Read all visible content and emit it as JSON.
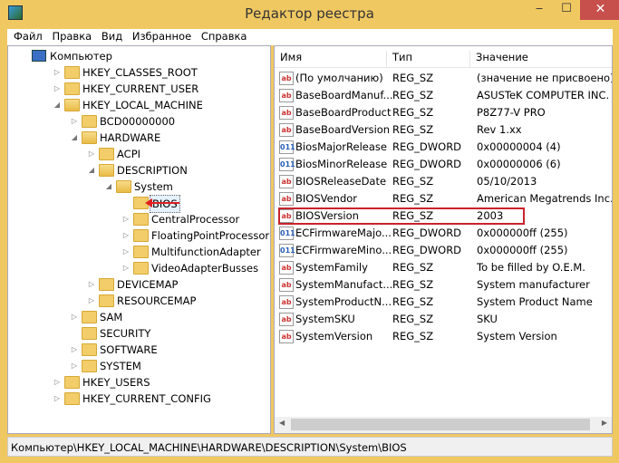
{
  "window": {
    "title": "Редактор реестра",
    "minimize": "‒",
    "maximize": "☐",
    "close": "✕"
  },
  "menu": [
    "Файл",
    "Правка",
    "Вид",
    "Избранное",
    "Справка"
  ],
  "tree": [
    {
      "label": "Компьютер",
      "depth": 0,
      "state": "open",
      "icon": "computer-icon"
    },
    {
      "label": "HKEY_CLASSES_ROOT",
      "depth": 1,
      "state": "closed"
    },
    {
      "label": "HKEY_CURRENT_USER",
      "depth": 1,
      "state": "closed"
    },
    {
      "label": "HKEY_LOCAL_MACHINE",
      "depth": 1,
      "state": "open"
    },
    {
      "label": "BCD00000000",
      "depth": 2,
      "state": "closed"
    },
    {
      "label": "HARDWARE",
      "depth": 2,
      "state": "open"
    },
    {
      "label": "ACPI",
      "depth": 3,
      "state": "closed"
    },
    {
      "label": "DESCRIPTION",
      "depth": 3,
      "state": "open"
    },
    {
      "label": "System",
      "depth": 4,
      "state": "open"
    },
    {
      "label": "BIOS",
      "depth": 5,
      "state": "none",
      "selected": true
    },
    {
      "label": "CentralProcessor",
      "depth": 5,
      "state": "closed"
    },
    {
      "label": "FloatingPointProcessor",
      "depth": 5,
      "state": "closed"
    },
    {
      "label": "MultifunctionAdapter",
      "depth": 5,
      "state": "closed"
    },
    {
      "label": "VideoAdapterBusses",
      "depth": 5,
      "state": "closed"
    },
    {
      "label": "DEVICEMAP",
      "depth": 3,
      "state": "closed"
    },
    {
      "label": "RESOURCEMAP",
      "depth": 3,
      "state": "closed"
    },
    {
      "label": "SAM",
      "depth": 2,
      "state": "closed"
    },
    {
      "label": "SECURITY",
      "depth": 2,
      "state": "none"
    },
    {
      "label": "SOFTWARE",
      "depth": 2,
      "state": "closed"
    },
    {
      "label": "SYSTEM",
      "depth": 2,
      "state": "closed"
    },
    {
      "label": "HKEY_USERS",
      "depth": 1,
      "state": "closed"
    },
    {
      "label": "HKEY_CURRENT_CONFIG",
      "depth": 1,
      "state": "closed"
    }
  ],
  "list": {
    "columns": [
      "Имя",
      "Тип",
      "Значение"
    ],
    "rows": [
      {
        "name": "(По умолчанию)",
        "type": "REG_SZ",
        "value": "(значение не присвоено)",
        "icon": "ab"
      },
      {
        "name": "BaseBoardManuf...",
        "type": "REG_SZ",
        "value": "ASUSTeK COMPUTER INC.",
        "icon": "ab"
      },
      {
        "name": "BaseBoardProduct",
        "type": "REG_SZ",
        "value": "P8Z77-V PRO",
        "icon": "ab"
      },
      {
        "name": "BaseBoardVersion",
        "type": "REG_SZ",
        "value": "Rev 1.xx",
        "icon": "ab"
      },
      {
        "name": "BiosMajorRelease",
        "type": "REG_DWORD",
        "value": "0x00000004 (4)",
        "icon": "dword"
      },
      {
        "name": "BiosMinorRelease",
        "type": "REG_DWORD",
        "value": "0x00000006 (6)",
        "icon": "dword"
      },
      {
        "name": "BIOSReleaseDate",
        "type": "REG_SZ",
        "value": "05/10/2013",
        "icon": "ab"
      },
      {
        "name": "BIOSVendor",
        "type": "REG_SZ",
        "value": "American Megatrends Inc.",
        "icon": "ab"
      },
      {
        "name": "BIOSVersion",
        "type": "REG_SZ",
        "value": "2003",
        "icon": "ab",
        "highlighted": true
      },
      {
        "name": "ECFirmwareMajo...",
        "type": "REG_DWORD",
        "value": "0x000000ff (255)",
        "icon": "dword"
      },
      {
        "name": "ECFirmwareMino...",
        "type": "REG_DWORD",
        "value": "0x000000ff (255)",
        "icon": "dword"
      },
      {
        "name": "SystemFamily",
        "type": "REG_SZ",
        "value": "To be filled by O.E.M.",
        "icon": "ab"
      },
      {
        "name": "SystemManufact...",
        "type": "REG_SZ",
        "value": "System manufacturer",
        "icon": "ab"
      },
      {
        "name": "SystemProductN...",
        "type": "REG_SZ",
        "value": "System Product Name",
        "icon": "ab"
      },
      {
        "name": "SystemSKU",
        "type": "REG_SZ",
        "value": "SKU",
        "icon": "ab"
      },
      {
        "name": "SystemVersion",
        "type": "REG_SZ",
        "value": "System Version",
        "icon": "ab"
      }
    ]
  },
  "icons": {
    "ab": "ab",
    "dword": "011"
  },
  "status": "Компьютер\\HKEY_LOCAL_MACHINE\\HARDWARE\\DESCRIPTION\\System\\BIOS",
  "colors": {
    "titlebar": "#f0c862",
    "close": "#c7504c",
    "highlight": "#c8232c",
    "arrow": "#e02020"
  }
}
